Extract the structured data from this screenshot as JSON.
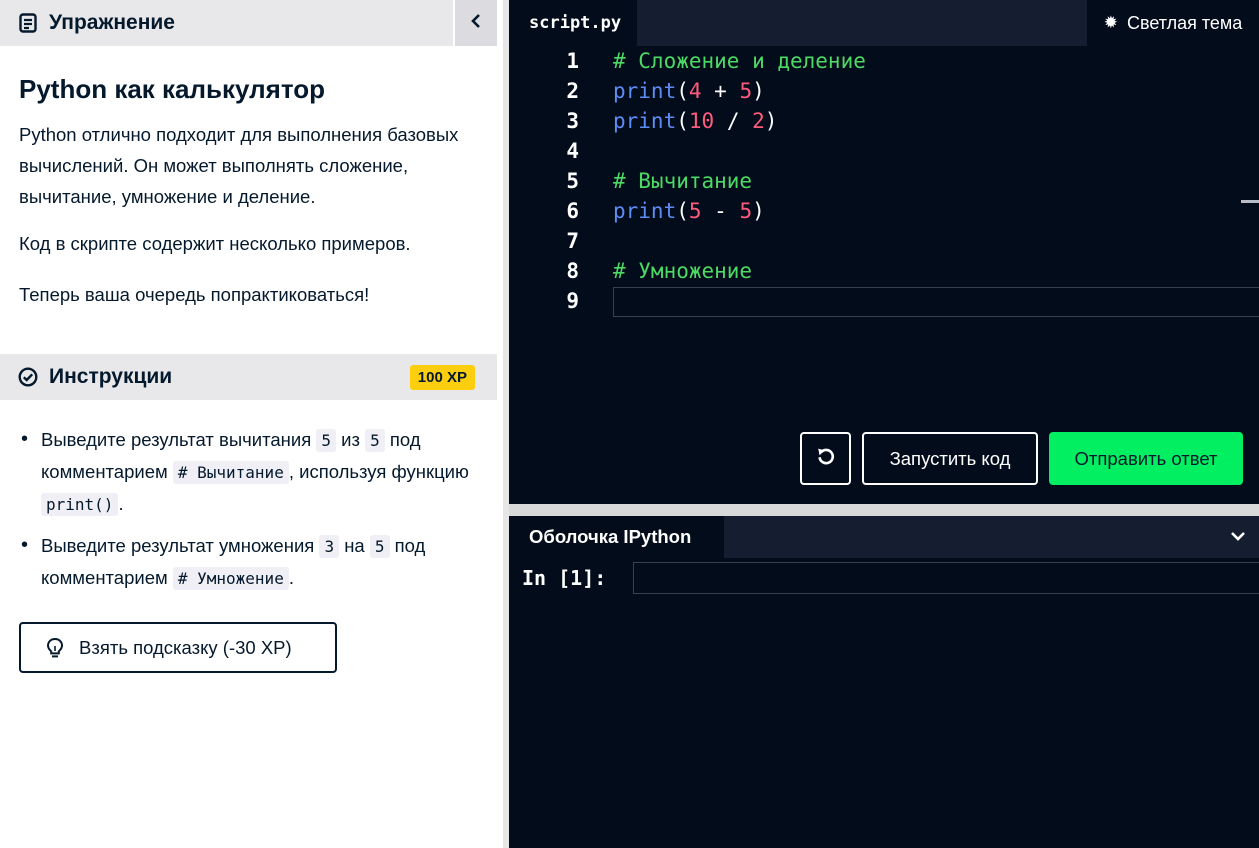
{
  "exercise": {
    "header": "Упражнение",
    "title": "Python как калькулятор",
    "paragraphs": [
      "Python отлично подходит для выполнения базовых вычислений. Он может выполнять сложение, вычитание, умножение и деление.",
      "Код в скрипте содержит несколько примеров.",
      "Теперь ваша очередь попрактиковаться!"
    ]
  },
  "instructions": {
    "header": "Инструкции",
    "xp": "100 XP",
    "item1": {
      "t1": "Выведите результат вычитания ",
      "c1": "5",
      "t2": " из ",
      "c2": "5",
      "t3": " под комментарием ",
      "c3": "# Вычитание",
      "t4": ", используя функцию ",
      "c4": "print()",
      "t5": "."
    },
    "item2": {
      "t1": "Выведите результат умножения ",
      "c1": "3",
      "t2": " на ",
      "c2": "5",
      "t3": " под комментарием ",
      "c3": "# Умножение",
      "t4": "."
    },
    "hint_button": "Взять подсказку (-30 XP)"
  },
  "editor": {
    "tab": "script.py",
    "theme_button": "Светлая тема",
    "lines": {
      "n1": "1",
      "n2": "2",
      "n3": "3",
      "n4": "4",
      "n5": "5",
      "n6": "6",
      "n7": "7",
      "n8": "8",
      "n9": "9",
      "l1_comment": "# Сложение и деление",
      "l2_fn": "print",
      "l2_open": "(",
      "l2_a": "4",
      "l2_op": " + ",
      "l2_b": "5",
      "l2_close": ")",
      "l3_fn": "print",
      "l3_open": "(",
      "l3_a": "10",
      "l3_op": " / ",
      "l3_b": "2",
      "l3_close": ")",
      "l5_comment": "# Вычитание",
      "l6_fn": "print",
      "l6_open": "(",
      "l6_a": "5",
      "l6_op": " - ",
      "l6_b": "5",
      "l6_close": ")",
      "l8_comment": "# Умножение"
    },
    "run_button": "Запустить код",
    "submit_button": "Отправить ответ"
  },
  "shell": {
    "tab": "Оболочка IPython",
    "prompt": "In [1]:",
    "input_value": ""
  },
  "icons": {
    "exercise": "document-icon",
    "collapse": "chevron-left-icon",
    "instructions": "check-circle-icon",
    "hint": "lightbulb-icon",
    "theme": "sun-icon",
    "reset": "undo-icon",
    "shell_toggle": "chevron-down-icon"
  },
  "colors": {
    "accent_green": "#03ef62",
    "xp_yellow": "#fcce0d",
    "editor_bg": "#030c1b",
    "comment": "#4cd964",
    "function": "#5d8cf5",
    "number": "#ff5b7c"
  }
}
